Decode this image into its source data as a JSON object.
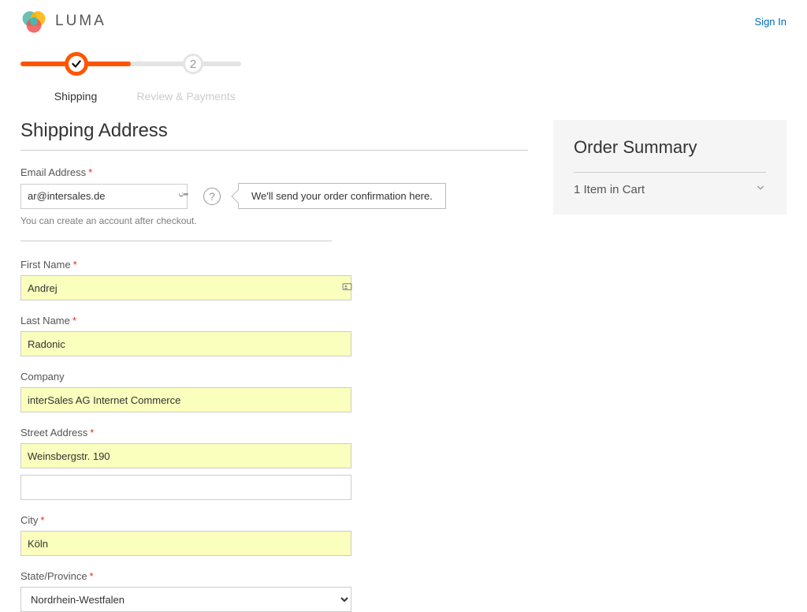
{
  "header": {
    "brand": "LUMA",
    "signin": "Sign In"
  },
  "progress": {
    "step1": "Shipping",
    "step2": "Review & Payments",
    "step2_num": "2"
  },
  "page": {
    "title": "Shipping Address"
  },
  "email": {
    "label": "Email Address",
    "value": "ar@intersales.de",
    "note": "You can create an account after checkout.",
    "tooltip": "We'll send your order confirmation here."
  },
  "fields": {
    "first_name_label": "First Name",
    "first_name": "Andrej",
    "last_name_label": "Last Name",
    "last_name": "Radonic",
    "company_label": "Company",
    "company": "interSales AG Internet Commerce",
    "street_label": "Street Address",
    "street1": "Weinsbergstr. 190",
    "street2": "",
    "city_label": "City",
    "city": "Köln",
    "state_label": "State/Province",
    "state": "Nordrhein-Westfalen"
  },
  "summary": {
    "title": "Order Summary",
    "cart_line": "1 Item in Cart"
  }
}
